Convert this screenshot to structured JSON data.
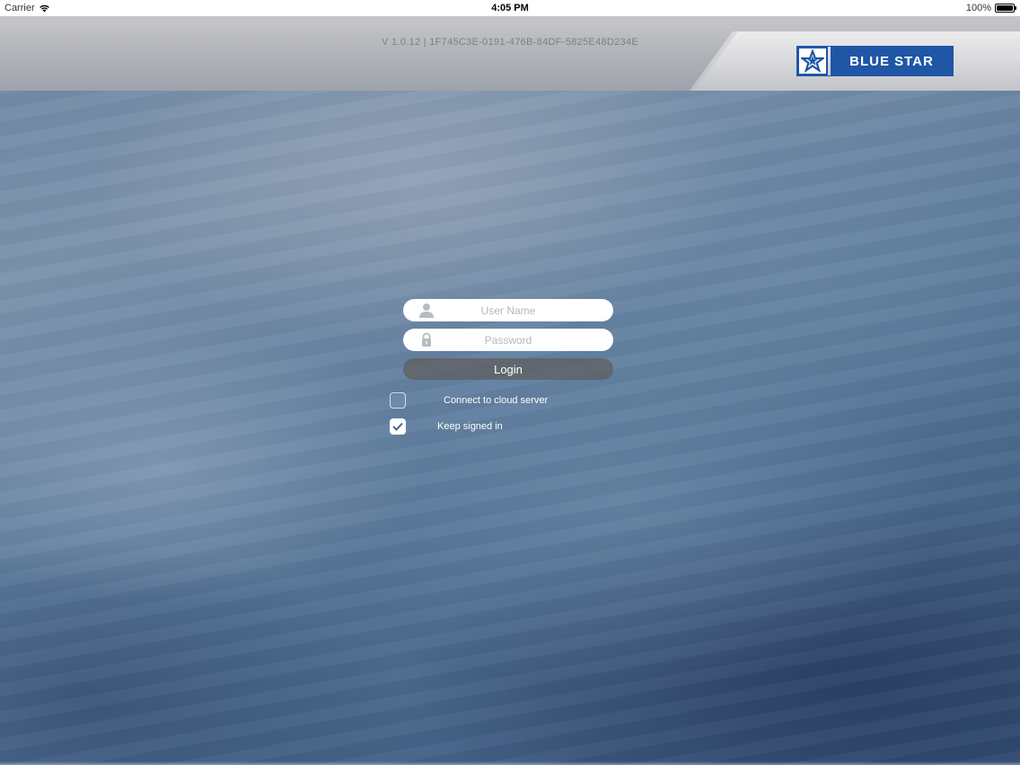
{
  "status_bar": {
    "carrier": "Carrier",
    "time": "4:05 PM",
    "battery": "100%",
    "battery_level": 1.0
  },
  "header": {
    "version": "V 1.0.12 | 1F745C3E-0191-476B-84DF-5825E48D234E",
    "brand": "BLUE STAR",
    "brand_color": "#1f56a6"
  },
  "login": {
    "username_placeholder": "User Name",
    "username_value": "",
    "username_icon": "user-icon",
    "password_placeholder": "Password",
    "password_value": "",
    "password_icon": "lock-icon",
    "login_label": "Login"
  },
  "options": {
    "cloud_label": "Connect to cloud server",
    "cloud_checked": false,
    "keep_label": "Keep signed in",
    "keep_checked": true
  }
}
